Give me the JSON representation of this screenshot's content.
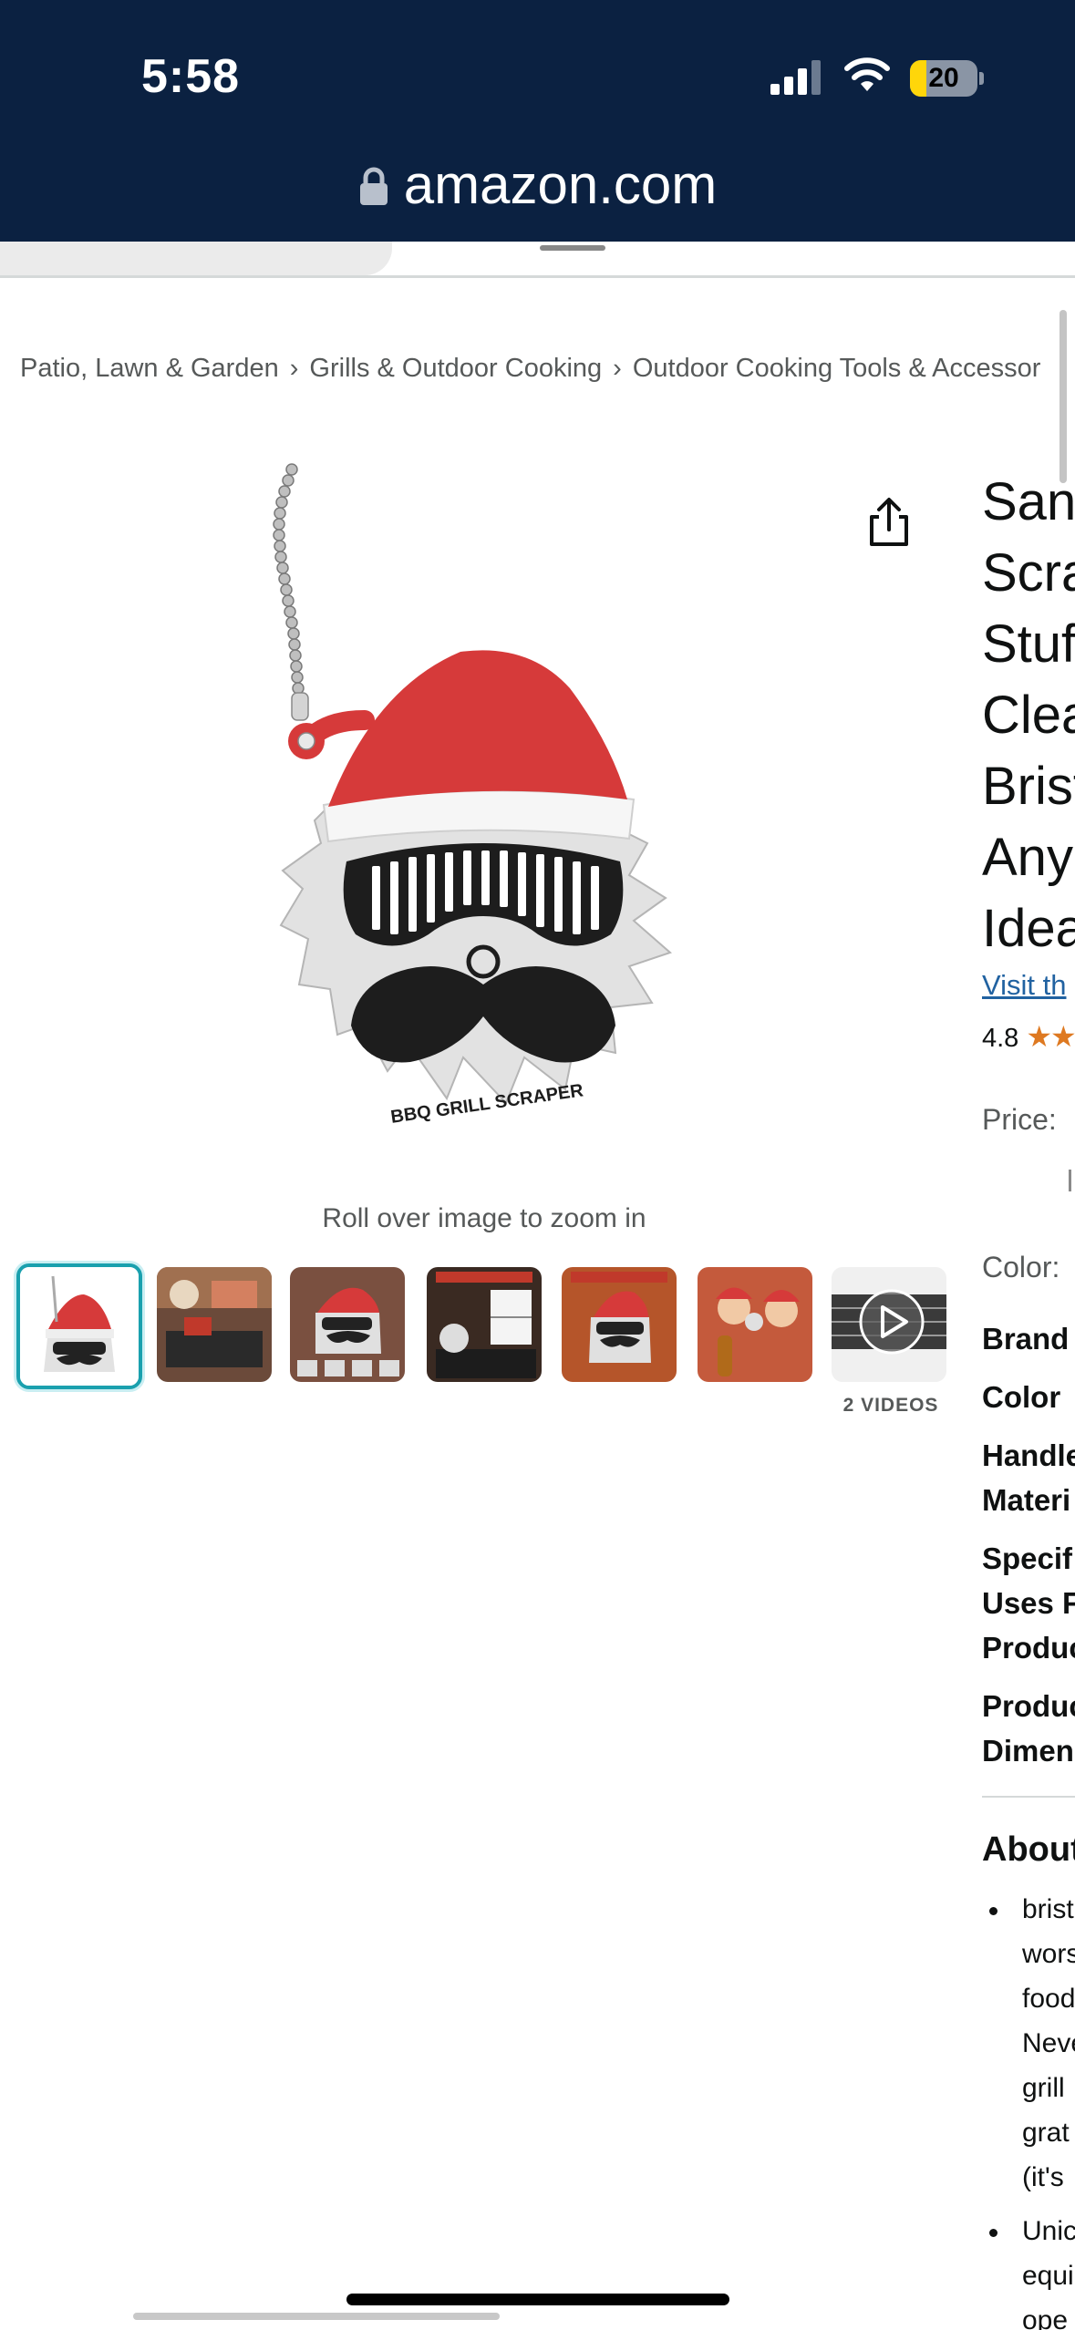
{
  "status_bar": {
    "time": "5:58",
    "battery": "20"
  },
  "url_bar": {
    "domain": "amazon.com"
  },
  "breadcrumb": [
    "Patio, Lawn & Garden",
    "Grills & Outdoor Cooking",
    "Outdoor Cooking Tools & Accessor"
  ],
  "image": {
    "product_text": "BBQ GRILL SCRAPER",
    "zoom_hint": "Roll over image to zoom in",
    "videos_label": "2 VIDEOS"
  },
  "product": {
    "title_lines": [
      "Sant",
      "Scra",
      "Stuf",
      "Clea",
      "Brist",
      "Any",
      "Idea"
    ],
    "visit_store": "Visit th",
    "rating": "4.8",
    "price_label": "Price:",
    "color_label": "Color:",
    "specs": [
      "Brand",
      "Color",
      "Handle",
      "Materi",
      "Specif",
      "Uses F",
      "Produc",
      "Produc",
      "Dimen"
    ],
    "about_heading": "About",
    "bullets": [
      [
        "brist",
        "wors",
        "food",
        "Neve",
        "grill",
        "grat",
        "(it's"
      ],
      [
        "Unic",
        "equi",
        "ope"
      ]
    ]
  },
  "colors": {
    "header_bg": "#0b2141",
    "accent_teal": "#1aa0ae",
    "link": "#2162a1",
    "star": "#de7921",
    "santa_red": "#d63a3a"
  }
}
